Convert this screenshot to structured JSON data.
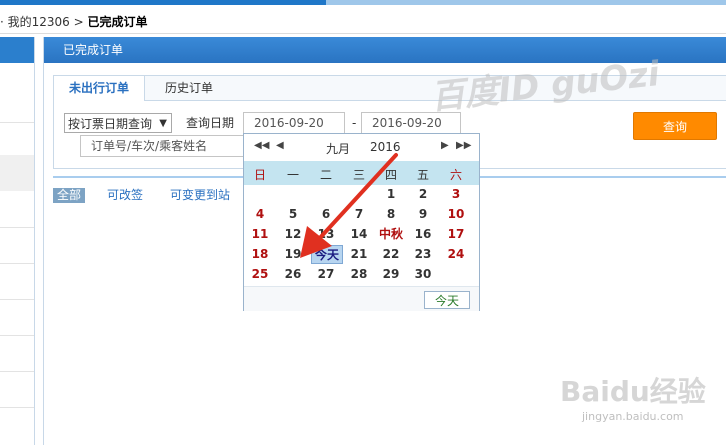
{
  "breadcrumb": {
    "prefix": "· 我的12306",
    "sep": ">",
    "current": "已完成订单"
  },
  "panel": {
    "title": "已完成订单"
  },
  "tabs": [
    "未出行订单",
    "历史订单"
  ],
  "filter": {
    "date_type_selected": "按订票日期查询",
    "date_label": "查询日期",
    "start_date": "2016-09-20",
    "end_date": "2016-09-20",
    "range_sep": "-",
    "keyword_placeholder": "订单号/车次/乘客姓名",
    "query_button": "查询"
  },
  "filters": [
    "全部",
    "可改签",
    "可变更到站"
  ],
  "calendar": {
    "month": "九月",
    "year": "2016",
    "weekdays": [
      "日",
      "一",
      "二",
      "三",
      "四",
      "五",
      "六"
    ],
    "days": [
      [
        "",
        "",
        "",
        "",
        "1",
        "2",
        "3"
      ],
      [
        "4",
        "5",
        "6",
        "7",
        "8",
        "9",
        "10"
      ],
      [
        "11",
        "12",
        "13",
        "14",
        "中秋",
        "16",
        "17"
      ],
      [
        "18",
        "19",
        "今天",
        "21",
        "22",
        "23",
        "24"
      ],
      [
        "25",
        "26",
        "27",
        "28",
        "29",
        "30",
        ""
      ]
    ],
    "today_button": "今天"
  },
  "watermark": {
    "text": "百度ID guOzi",
    "brand": "Baidu经验",
    "url": "jingyan.baidu.com"
  },
  "colors": {
    "accent": "#2a74c2",
    "query": "#ff8a00",
    "arrow": "#e03020"
  }
}
